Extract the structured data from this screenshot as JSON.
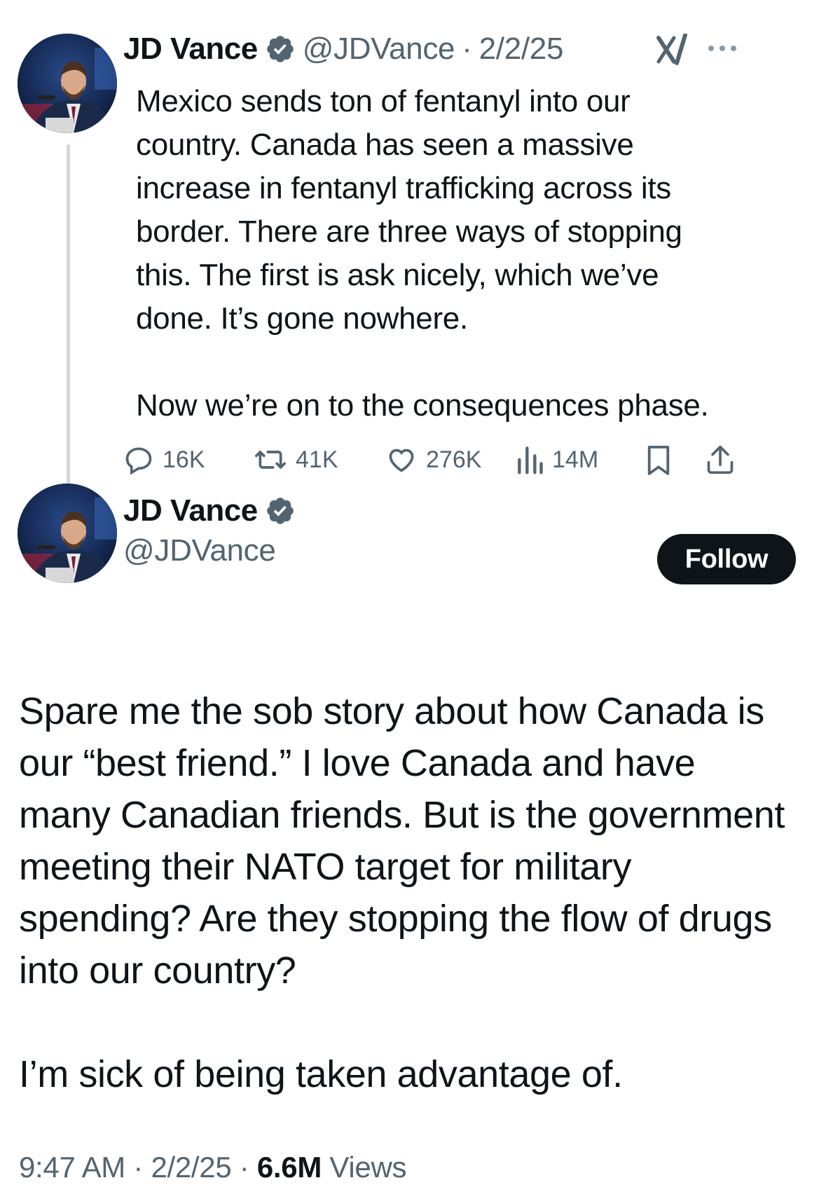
{
  "tweet1": {
    "author_name": "JD Vance",
    "handle": "@JDVance",
    "separator": "·",
    "date": "2/2/25",
    "avatar": "avatar-photo",
    "text": "Mexico sends ton of fentanyl into our\ncountry. Canada has seen a massive\nincrease in fentanyl trafficking across its\nborder. There are three ways of stopping\nthis. The first is ask nicely, which we’ve\ndone. It’s gone nowhere.\n\nNow we’re on to the consequences phase.",
    "stats": {
      "replies": "16K",
      "reposts": "41K",
      "likes": "276K",
      "views": "14M"
    },
    "icons": {
      "verified": "verified-badge-icon",
      "grok": "grok-icon",
      "more": "more-icon",
      "reply": "reply-icon",
      "repost": "repost-icon",
      "like": "like-icon",
      "views": "views-icon",
      "bookmark": "bookmark-icon",
      "share": "share-icon"
    }
  },
  "tweet2": {
    "author_name": "JD Vance",
    "handle": "@JDVance",
    "follow_label": "Follow",
    "text": "Spare me the sob story about how Canada is\nour “best friend.” I love Canada and have\nmany Canadian friends. But is the government\nmeeting their NATO target for military\nspending? Are they stopping the flow of drugs\ninto our country?\n\nI’m sick of being taken advantage of.",
    "time": "9:47 AM",
    "date": "2/2/25",
    "separator": "·",
    "view_count": "6.6M",
    "views_label": "Views"
  },
  "colors": {
    "text": "#0f1419",
    "secondary": "#536471",
    "verified_blue": "#536471",
    "thread_line": "#cfd9de",
    "follow_bg": "#0f1419"
  }
}
